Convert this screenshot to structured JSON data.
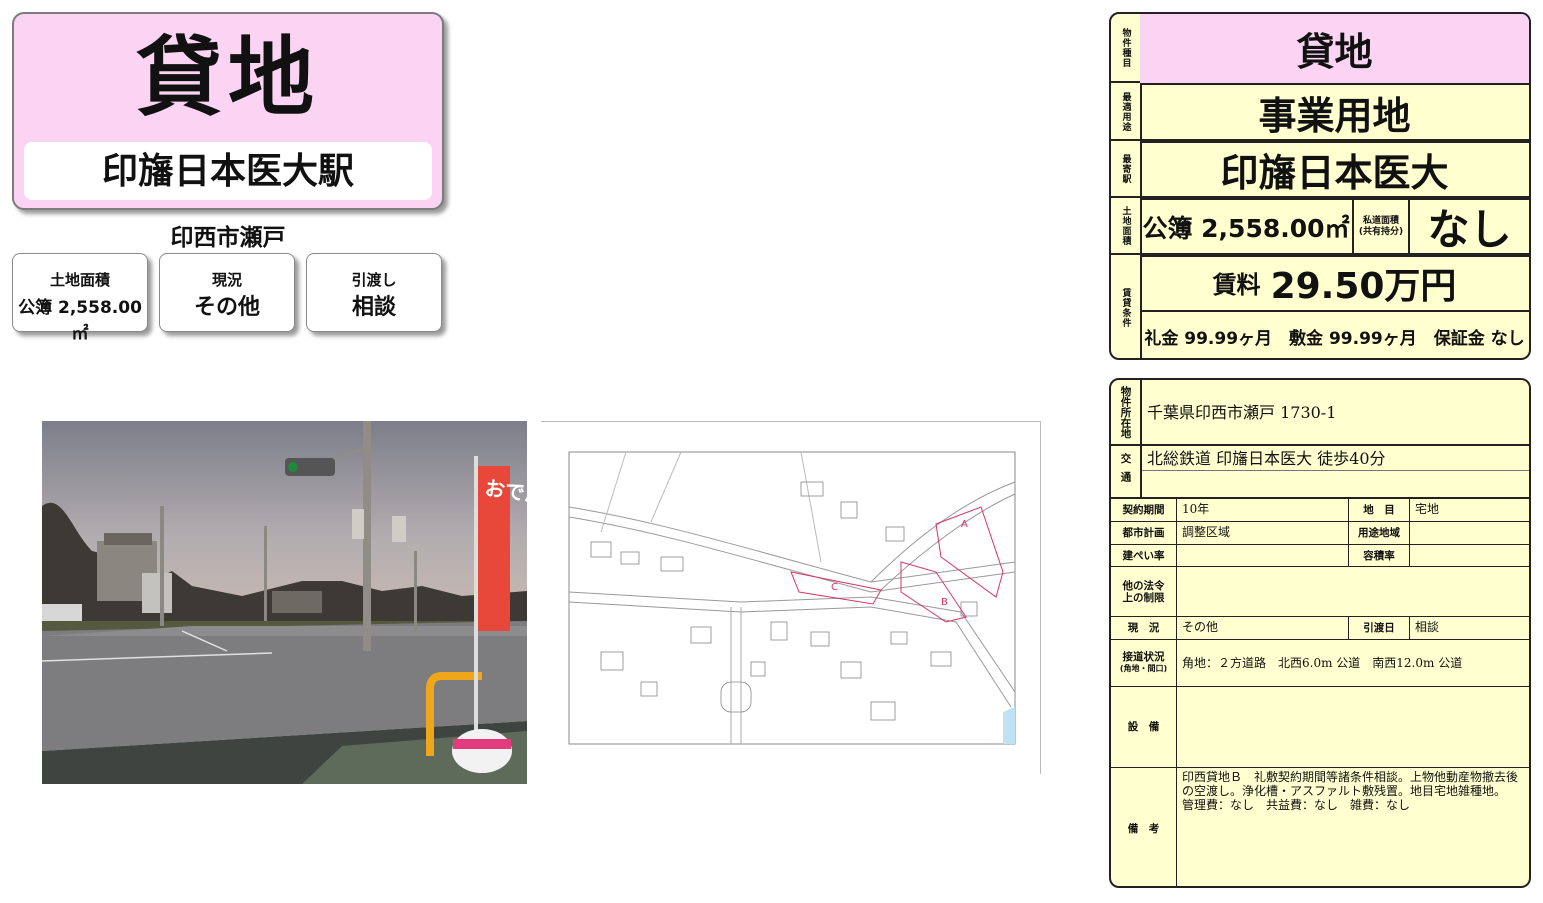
{
  "header": {
    "type_big": "貸地",
    "station": "印旛日本医大駅",
    "address_short": "印西市瀬戸"
  },
  "summary_cards": [
    {
      "label": "土地面積",
      "value": "公簿 2,558.00㎡"
    },
    {
      "label": "現況",
      "value": "その他"
    },
    {
      "label": "引渡し",
      "value": "相談"
    }
  ],
  "photo": {
    "banner_text": "おでんセール"
  },
  "map": {
    "parcel_labels": [
      "A",
      "B",
      "C"
    ]
  },
  "property_summary": {
    "type_label": "物件種目",
    "type_value": "貸地",
    "use_label": "最適用途",
    "use_value": "事業用地",
    "station_label": "最寄駅",
    "station_value": "印旛日本医大",
    "area_label": "土地面積",
    "area_value": "公簿 2,558.00㎡",
    "private_road_label_1": "私道面積",
    "private_road_label_2": "(共有持分)",
    "private_road_value": "なし",
    "rent_label": "賃貸条件",
    "rent_prefix": "賃料",
    "rent_value": "29.50万円",
    "deposits": "礼金 99.99ヶ月　敷金 99.99ヶ月　保証金 なし"
  },
  "details": {
    "location_label": "物件所在地",
    "location": "千葉県印西市瀬戸 1730-1",
    "transport_label": "交通",
    "transport": "北総鉄道 印旛日本医大 徒歩40分",
    "contract_period_label": "契約期間",
    "contract_period": "10年",
    "land_category_label": "地　目",
    "land_category": "宅地",
    "city_plan_label": "都市計画",
    "city_plan": "調整区域",
    "zoning_label": "用途地域",
    "zoning": "",
    "bcr_label": "建ぺい率",
    "bcr": "",
    "far_label": "容積率",
    "far": "",
    "other_law_label_1": "他の法令",
    "other_law_label_2": "上の制限",
    "other_law": "",
    "status_label": "現　況",
    "status": "その他",
    "delivery_label": "引渡日",
    "delivery": "相談",
    "road_label_1": "接道状況",
    "road_label_2": "(角地・間口)",
    "road": "角地：２方道路　北西6.0m 公道　南西12.0m 公道",
    "facilities_label": "設　備",
    "facilities": "",
    "remarks_label": "備　考",
    "remarks_1": "印西貸地Ｂ　礼敷契約期間等諸条件相談。上物他動産物撤去後",
    "remarks_2": "の空渡し。浄化槽・アスファルト敷残置。地目宅地雑種地。",
    "remarks_3": "管理費：なし　共益費：なし　雑費：なし"
  },
  "colors": {
    "header_pink": "#fbd3f3",
    "table_yellow": "#ffffcf",
    "banner_red": "#e8483a",
    "map_parcel": "#d8336a"
  }
}
